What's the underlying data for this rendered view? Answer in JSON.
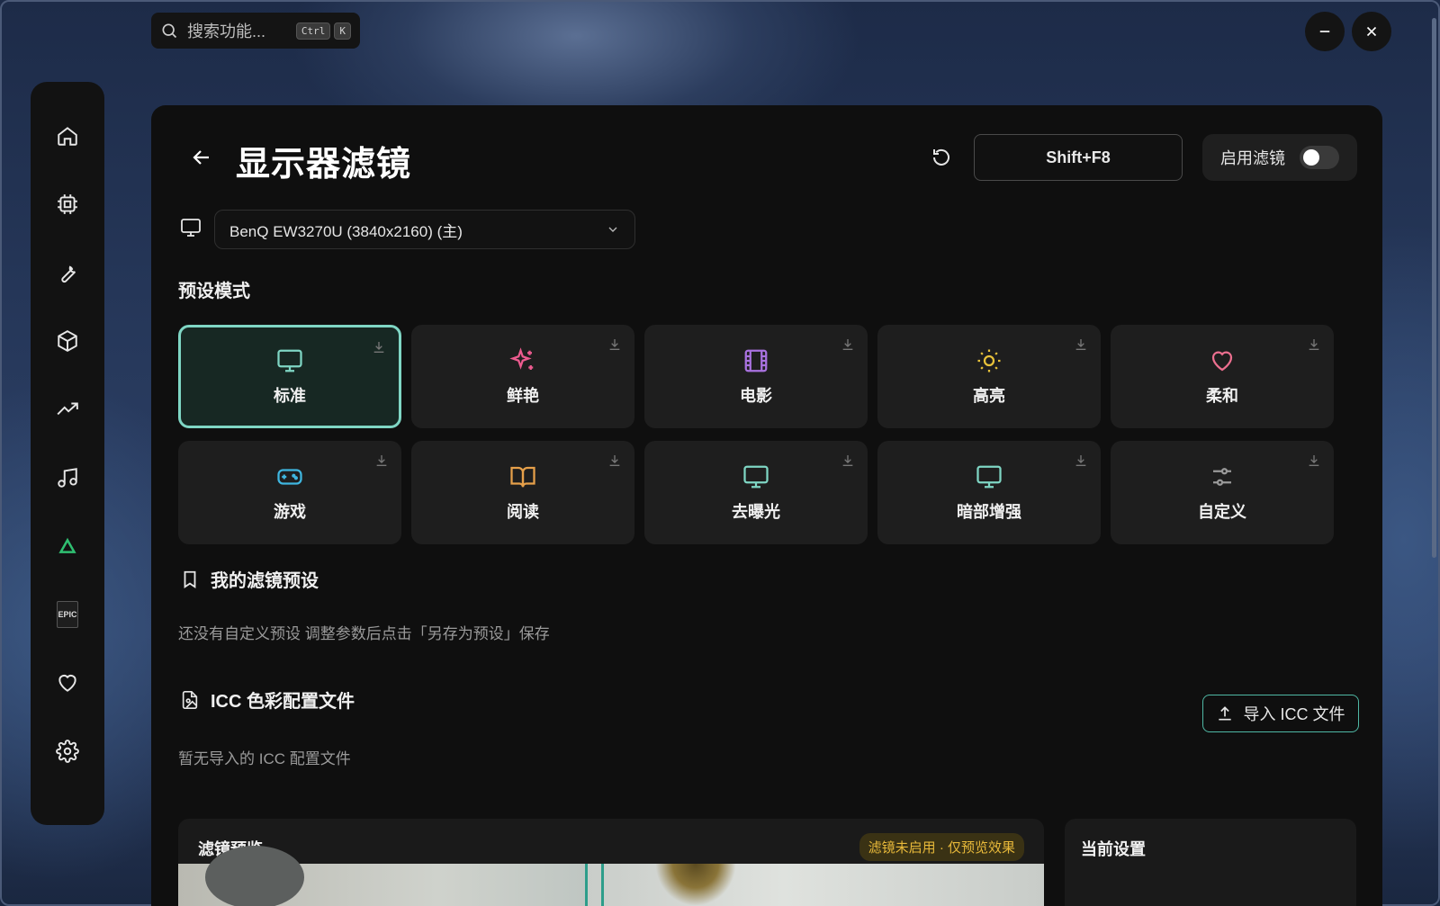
{
  "search": {
    "placeholder": "搜索功能...",
    "key1": "Ctrl",
    "key2": "K"
  },
  "window": {
    "minimize": "minimize-icon",
    "close": "close-icon"
  },
  "sidebar": {
    "items": [
      {
        "icon": "home-icon"
      },
      {
        "icon": "chip-icon"
      },
      {
        "icon": "wrench-icon"
      },
      {
        "icon": "package-icon"
      },
      {
        "icon": "trending-icon"
      },
      {
        "icon": "music-icon"
      },
      {
        "icon": "triangle-icon",
        "color": "#2fbf71"
      },
      {
        "icon": "epic-games-icon",
        "text": "EPIC"
      },
      {
        "icon": "heart-icon"
      },
      {
        "icon": "gear-icon"
      }
    ]
  },
  "header": {
    "title": "显示器滤镜",
    "shortcut": "Shift+F8",
    "enable_label": "启用滤镜",
    "enabled": false
  },
  "monitor": {
    "selected": "BenQ EW3270U (3840x2160) (主)"
  },
  "presets": {
    "title": "预设模式",
    "items": [
      {
        "label": "标准",
        "icon": "monitor-icon",
        "color": "#7fd6c4",
        "active": true
      },
      {
        "label": "鲜艳",
        "icon": "sparkles-icon",
        "color": "#ec5b8f"
      },
      {
        "label": "电影",
        "icon": "film-icon",
        "color": "#a972e0"
      },
      {
        "label": "高亮",
        "icon": "sun-icon",
        "color": "#e8c23a"
      },
      {
        "label": "柔和",
        "icon": "heart-icon",
        "color": "#ec6f8f"
      },
      {
        "label": "游戏",
        "icon": "gamepad-icon",
        "color": "#3fb6e0"
      },
      {
        "label": "阅读",
        "icon": "book-icon",
        "color": "#e6a04a"
      },
      {
        "label": "去曝光",
        "icon": "monitor-icon",
        "color": "#7fd6c4"
      },
      {
        "label": "暗部增强",
        "icon": "monitor-icon",
        "color": "#7fd6c4"
      },
      {
        "label": "自定义",
        "icon": "sliders-icon",
        "color": "#9a9a9a"
      }
    ]
  },
  "my_presets": {
    "title": "我的滤镜预设",
    "empty": "还没有自定义预设 调整参数后点击「另存为预设」保存"
  },
  "icc": {
    "title": "ICC 色彩配置文件",
    "import_label": "导入 ICC 文件",
    "empty": "暂无导入的 ICC 配置文件"
  },
  "preview": {
    "title": "滤镜预览",
    "badge": "滤镜未启用 · 仅预览效果"
  },
  "current": {
    "title": "当前设置"
  }
}
